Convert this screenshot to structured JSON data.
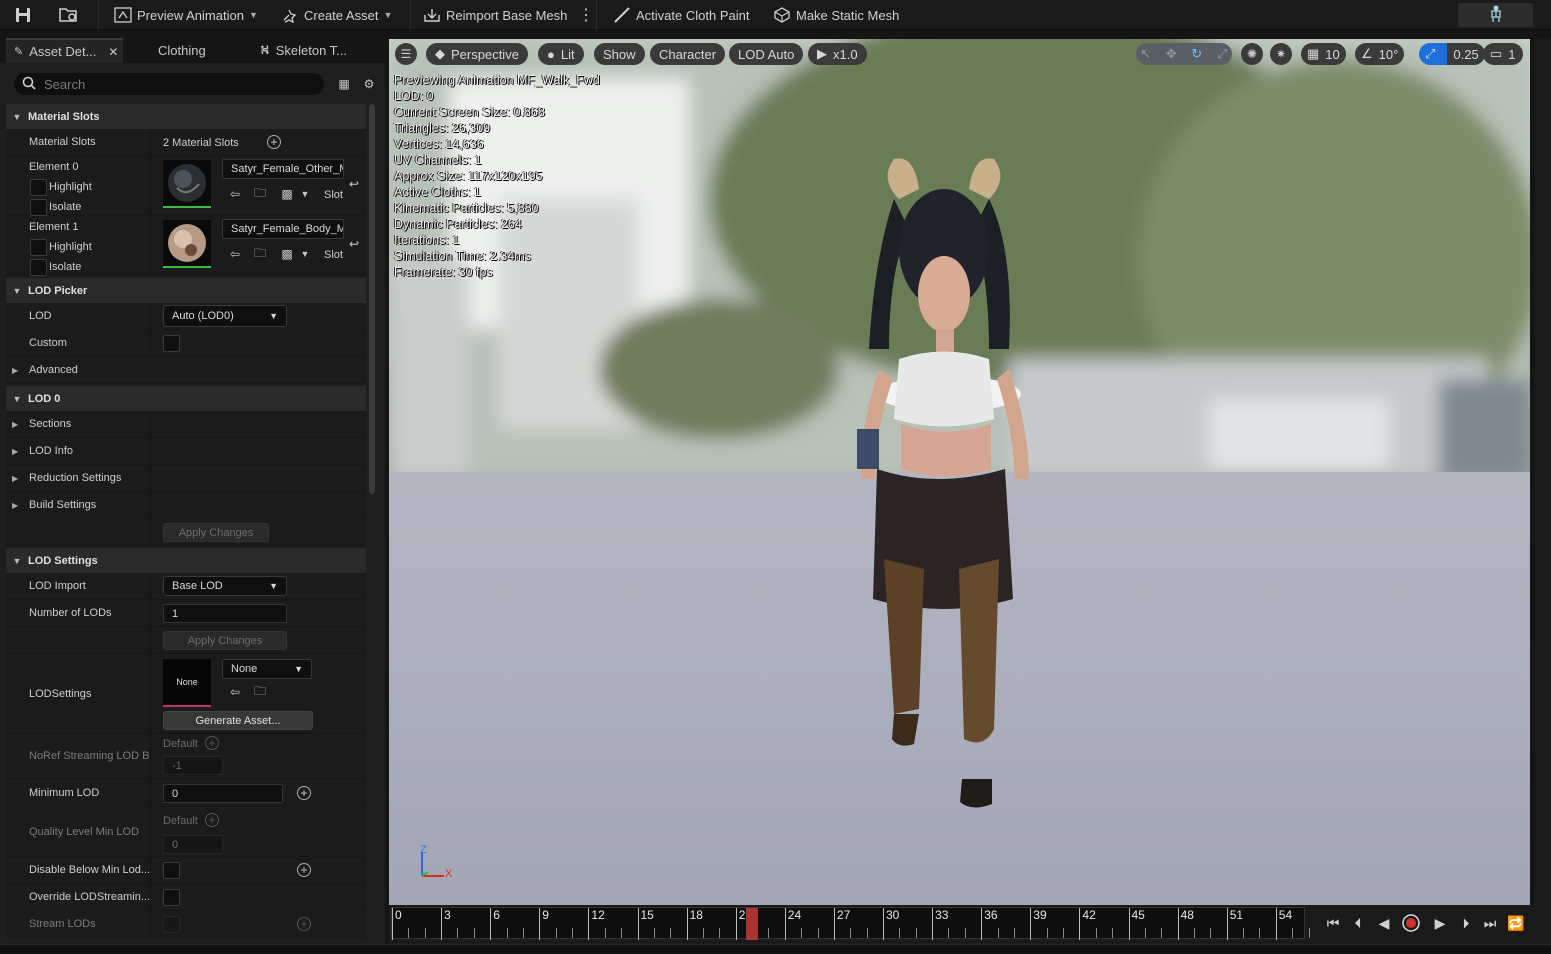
{
  "toolbar": {
    "preview_animation": "Preview Animation",
    "create_asset": "Create Asset",
    "reimport_base_mesh": "Reimport Base Mesh",
    "activate_cloth_paint": "Activate Cloth Paint",
    "make_static_mesh": "Make Static Mesh"
  },
  "tabs": {
    "asset_details": "Asset Det...",
    "clothing": "Clothing",
    "skeleton_tree": "Skeleton T..."
  },
  "search": {
    "placeholder": "Search"
  },
  "material_slots": {
    "category": "Material Slots",
    "label": "Material Slots",
    "count": "2 Material Slots",
    "element0": "Element 0",
    "element1": "Element 1",
    "highlight": "Highlight",
    "isolate": "Isolate",
    "mat0": "Satyr_Female_Other_M",
    "mat1": "Satyr_Female_Body_M",
    "slot": "Slot"
  },
  "lod_picker": {
    "category": "LOD Picker",
    "lod_label": "LOD",
    "lod_value": "Auto (LOD0)",
    "custom_label": "Custom",
    "advanced_label": "Advanced"
  },
  "lod0": {
    "category": "LOD 0",
    "sections": "Sections",
    "lod_info": "LOD Info",
    "reduction": "Reduction Settings",
    "build": "Build Settings",
    "apply": "Apply Changes"
  },
  "lod_settings": {
    "category": "LOD Settings",
    "lod_import_label": "LOD Import",
    "lod_import_value": "Base LOD",
    "num_lods_label": "Number of LODs",
    "num_lods_value": "1",
    "apply": "Apply Changes",
    "lodsettings_label": "LODSettings",
    "none_thumb": "None",
    "none_combo": "None",
    "generate": "Generate Asset...",
    "noref_label": "NoRef Streaming LOD B",
    "default1": "Default",
    "noref_value": "-1",
    "min_lod_label": "Minimum LOD",
    "min_lod_value": "0",
    "quality_label": "Quality Level Min LOD",
    "default2": "Default",
    "quality_value": "0",
    "disable_below": "Disable Below Min Lod...",
    "override_streaming": "Override LODStreamin...",
    "stream_lods": "Stream LODs"
  },
  "viewport": {
    "perspective": "Perspective",
    "lit": "Lit",
    "show": "Show",
    "character": "Character",
    "lod_auto": "LOD Auto",
    "speed": "x1.0",
    "grid": "10",
    "angle": "10°",
    "scale": "0.25",
    "camera_speed": "1",
    "stats": [
      "Previewing Animation MF_Walk_Fwd",
      "LOD: 0",
      "Current Screen Size: 0.868",
      "Triangles: 26,309",
      "Vertices: 14,636",
      "UV Channels: 1",
      "Approx Size: 117x120x195",
      "Active Cloths: 1",
      "Kinematic Particles: 5,880",
      "Dynamic Particles: 264",
      "Iterations: 1",
      "Simulation Time: 2.34ms",
      "Framerate: 30 fps"
    ],
    "axis_z": "Z",
    "axis_x": "X"
  },
  "timeline": {
    "frames": [
      "0",
      "3",
      "6",
      "9",
      "12",
      "15",
      "18",
      "21",
      "24",
      "27",
      "30",
      "33",
      "36",
      "39",
      "42",
      "45",
      "48",
      "51",
      "54"
    ],
    "current_frame": 22
  },
  "colors": {
    "accent": "#1e6fd9",
    "playhead": "#aa3333",
    "thumb_border": "#3cbc3c",
    "none_border": "#c0306a"
  }
}
